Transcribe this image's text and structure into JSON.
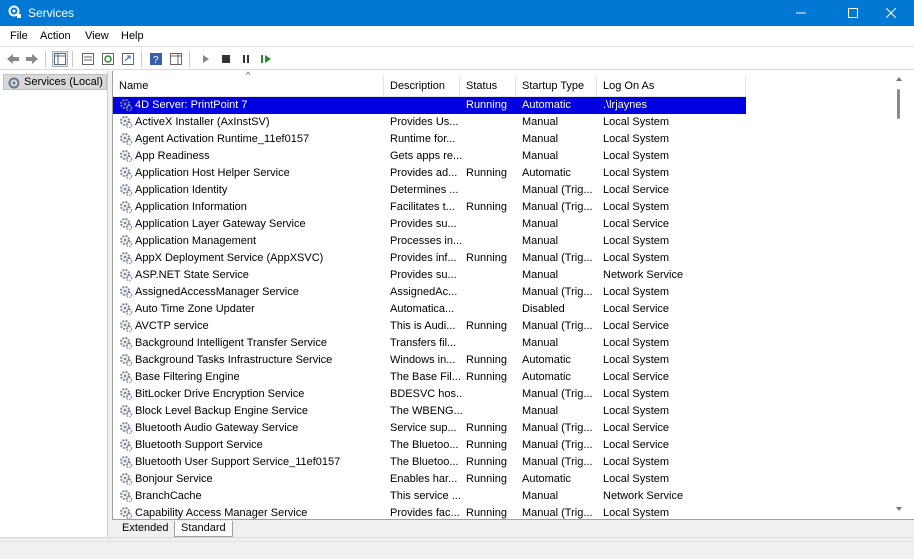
{
  "window": {
    "title": "Services"
  },
  "menu": [
    "File",
    "Action",
    "View",
    "Help"
  ],
  "tree": {
    "label": "Services (Local)"
  },
  "columns": [
    "Name",
    "Description",
    "Status",
    "Startup Type",
    "Log On As"
  ],
  "rows": [
    [
      "4D Server: PrintPoint 7",
      "",
      "Running",
      "Automatic",
      ".\\lrjaynes"
    ],
    [
      "ActiveX Installer (AxInstSV)",
      "Provides Us...",
      "",
      "Manual",
      "Local System"
    ],
    [
      "Agent Activation Runtime_11ef0157",
      "Runtime for...",
      "",
      "Manual",
      "Local System"
    ],
    [
      "App Readiness",
      "Gets apps re...",
      "",
      "Manual",
      "Local System"
    ],
    [
      "Application Host Helper Service",
      "Provides ad...",
      "Running",
      "Automatic",
      "Local System"
    ],
    [
      "Application Identity",
      "Determines ...",
      "",
      "Manual (Trig...",
      "Local Service"
    ],
    [
      "Application Information",
      "Facilitates t...",
      "Running",
      "Manual (Trig...",
      "Local System"
    ],
    [
      "Application Layer Gateway Service",
      "Provides su...",
      "",
      "Manual",
      "Local Service"
    ],
    [
      "Application Management",
      "Processes in...",
      "",
      "Manual",
      "Local System"
    ],
    [
      "AppX Deployment Service (AppXSVC)",
      "Provides inf...",
      "Running",
      "Manual (Trig...",
      "Local System"
    ],
    [
      "ASP.NET State Service",
      "Provides su...",
      "",
      "Manual",
      "Network Service"
    ],
    [
      "AssignedAccessManager Service",
      "AssignedAc...",
      "",
      "Manual (Trig...",
      "Local System"
    ],
    [
      "Auto Time Zone Updater",
      "Automatica...",
      "",
      "Disabled",
      "Local Service"
    ],
    [
      "AVCTP service",
      "This is Audi...",
      "Running",
      "Manual (Trig...",
      "Local Service"
    ],
    [
      "Background Intelligent Transfer Service",
      "Transfers fil...",
      "",
      "Manual",
      "Local System"
    ],
    [
      "Background Tasks Infrastructure Service",
      "Windows in...",
      "Running",
      "Automatic",
      "Local System"
    ],
    [
      "Base Filtering Engine",
      "The Base Fil...",
      "Running",
      "Automatic",
      "Local Service"
    ],
    [
      "BitLocker Drive Encryption Service",
      "BDESVC hos...",
      "",
      "Manual (Trig...",
      "Local System"
    ],
    [
      "Block Level Backup Engine Service",
      "The WBENG...",
      "",
      "Manual",
      "Local System"
    ],
    [
      "Bluetooth Audio Gateway Service",
      "Service sup...",
      "Running",
      "Manual (Trig...",
      "Local Service"
    ],
    [
      "Bluetooth Support Service",
      "The Bluetoo...",
      "Running",
      "Manual (Trig...",
      "Local Service"
    ],
    [
      "Bluetooth User Support Service_11ef0157",
      "The Bluetoo...",
      "Running",
      "Manual (Trig...",
      "Local System"
    ],
    [
      "Bonjour Service",
      "Enables har...",
      "Running",
      "Automatic",
      "Local System"
    ],
    [
      "BranchCache",
      "This service ...",
      "",
      "Manual",
      "Network Service"
    ],
    [
      "Capability Access Manager Service",
      "Provides fac...",
      "Running",
      "Manual (Trig...",
      "Local System"
    ]
  ],
  "tabs": [
    "Extended",
    "Standard"
  ],
  "colors": {
    "titlebar": "#0078d4",
    "selection": "#0000e0"
  }
}
